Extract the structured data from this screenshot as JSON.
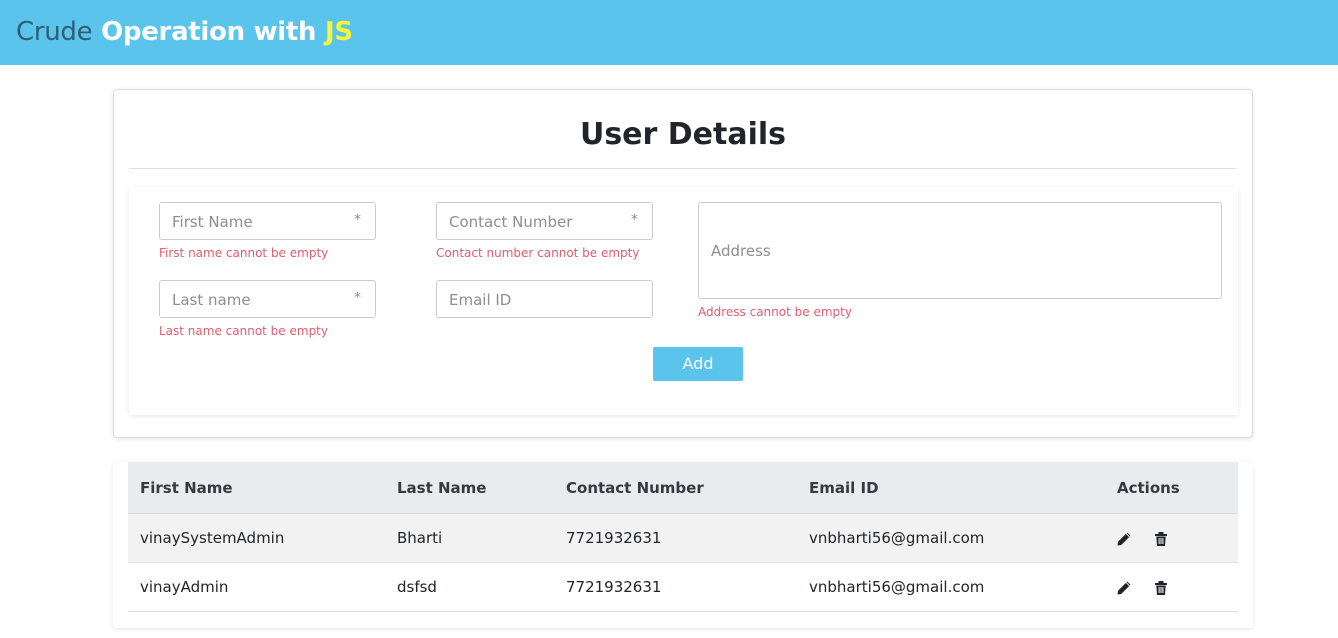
{
  "header": {
    "title_part1": "Crude",
    "title_part2": "Operation with",
    "title_part3": "JS",
    "background_color": "#5bc4ec"
  },
  "form": {
    "title": "User Details",
    "first_name": {
      "placeholder": "First Name",
      "required_mark": "*",
      "value": "",
      "error": "First name cannot be empty"
    },
    "last_name": {
      "placeholder": "Last name",
      "required_mark": "*",
      "value": "",
      "error": "Last name cannot be empty"
    },
    "contact_number": {
      "placeholder": "Contact Number",
      "required_mark": "*",
      "value": "",
      "error": "Contact number cannot be empty"
    },
    "email": {
      "placeholder": "Email ID",
      "value": ""
    },
    "address": {
      "placeholder": "Address",
      "value": "",
      "error": "Address cannot be empty"
    },
    "add_button": "Add",
    "error_color": "#e05d6f"
  },
  "table": {
    "headers": [
      "First Name",
      "Last Name",
      "Contact Number",
      "Email ID",
      "Actions"
    ],
    "rows": [
      {
        "first_name": "vinaySystemAdmin",
        "last_name": "Bharti",
        "contact": "7721932631",
        "email": "vnbharti56@gmail.com",
        "actions": [
          "edit-icon",
          "delete-icon"
        ]
      },
      {
        "first_name": "vinayAdmin",
        "last_name": "dsfsd",
        "contact": "7721932631",
        "email": "vnbharti56@gmail.com",
        "actions": [
          "edit-icon",
          "delete-icon"
        ]
      }
    ]
  }
}
